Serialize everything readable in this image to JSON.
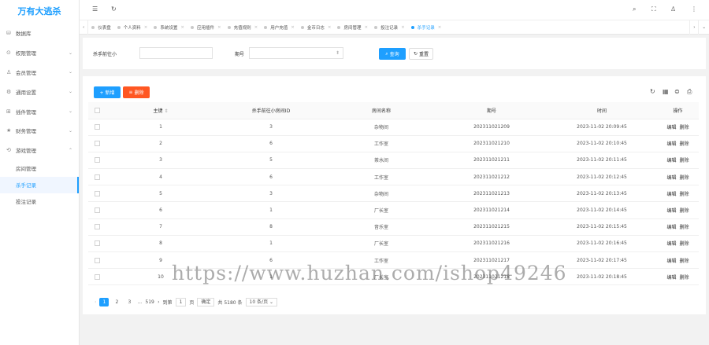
{
  "sidebar": {
    "logo": "万有大逃杀",
    "items": [
      {
        "label": "数据库",
        "icon": "database-icon",
        "glyph": "⛁",
        "chev": ""
      },
      {
        "label": "权限管理",
        "icon": "shield-icon",
        "glyph": "⊙",
        "chev": "⌄"
      },
      {
        "label": "会员管理",
        "icon": "user-icon",
        "glyph": "♙",
        "chev": "⌄"
      },
      {
        "label": "通用设置",
        "icon": "gear-icon",
        "glyph": "⚙",
        "chev": "⌄"
      },
      {
        "label": "插件管理",
        "icon": "plugin-icon",
        "glyph": "⊞",
        "chev": "⌄"
      },
      {
        "label": "财务管理",
        "icon": "finance-icon",
        "glyph": "★",
        "chev": "⌄"
      },
      {
        "label": "游戏管理",
        "icon": "game-icon",
        "glyph": "⟲",
        "chev": "⌃"
      }
    ],
    "sub_items": [
      {
        "label": "房间管理",
        "active": false
      },
      {
        "label": "杀手记录",
        "active": true
      },
      {
        "label": "投注记录",
        "active": false
      }
    ]
  },
  "tabs": [
    {
      "label": "仪表盘",
      "active": false,
      "closable": false
    },
    {
      "label": "个人资料",
      "active": false,
      "closable": true
    },
    {
      "label": "系统设置",
      "active": false,
      "closable": true
    },
    {
      "label": "应用插件",
      "active": false,
      "closable": true
    },
    {
      "label": "充值规则",
      "active": false,
      "closable": true
    },
    {
      "label": "用户充值",
      "active": false,
      "closable": true
    },
    {
      "label": "金币日志",
      "active": false,
      "closable": true
    },
    {
      "label": "房间管理",
      "active": false,
      "closable": true
    },
    {
      "label": "投注记录",
      "active": false,
      "closable": true
    },
    {
      "label": "杀手记录",
      "active": true,
      "closable": true
    }
  ],
  "search": {
    "field1_label": "杀手前往小",
    "field2_label": "期号",
    "query_label": "查询",
    "reset_label": "重置"
  },
  "toolbar": {
    "add_label": "+ 新增",
    "delete_label": "删除"
  },
  "table": {
    "headers": [
      "主键",
      "杀手前往小房间ID",
      "房间名称",
      "期号",
      "时间",
      "操作"
    ],
    "sort_glyph": "⇕",
    "edit_label": "编辑",
    "delete_label": "删除",
    "rows": [
      [
        "1",
        "3",
        "杂物间",
        "202311021209",
        "2023-11-02 20:09:45"
      ],
      [
        "2",
        "6",
        "工作室",
        "202311021210",
        "2023-11-02 20:10:45"
      ],
      [
        "3",
        "5",
        "茶水间",
        "202311021211",
        "2023-11-02 20:11:45"
      ],
      [
        "4",
        "6",
        "工作室",
        "202311021212",
        "2023-11-02 20:12:45"
      ],
      [
        "5",
        "3",
        "杂物间",
        "202311021213",
        "2023-11-02 20:13:45"
      ],
      [
        "6",
        "1",
        "厂长室",
        "202311021214",
        "2023-11-02 20:14:45"
      ],
      [
        "7",
        "8",
        "音乐室",
        "202311021215",
        "2023-11-02 20:15:45"
      ],
      [
        "8",
        "1",
        "厂长室",
        "202311021216",
        "2023-11-02 20:16:45"
      ],
      [
        "9",
        "6",
        "工作室",
        "202311021217",
        "2023-11-02 20:17:45"
      ],
      [
        "10",
        "1",
        "厂长室",
        "202311021218",
        "2023-11-02 20:18:45"
      ]
    ]
  },
  "pager": {
    "pages": [
      "1",
      "2",
      "3"
    ],
    "ellipsis": "...",
    "last_page": "519",
    "goto_label": "到第",
    "goto_value": "1",
    "page_unit": "页",
    "confirm_label": "确定",
    "total_label": "共 5180 条",
    "per_page": "10 条/页"
  },
  "watermark": "https://www.huzhan.com/ishop49246",
  "colors": {
    "accent": "#1e9fff",
    "danger": "#ff5722"
  }
}
